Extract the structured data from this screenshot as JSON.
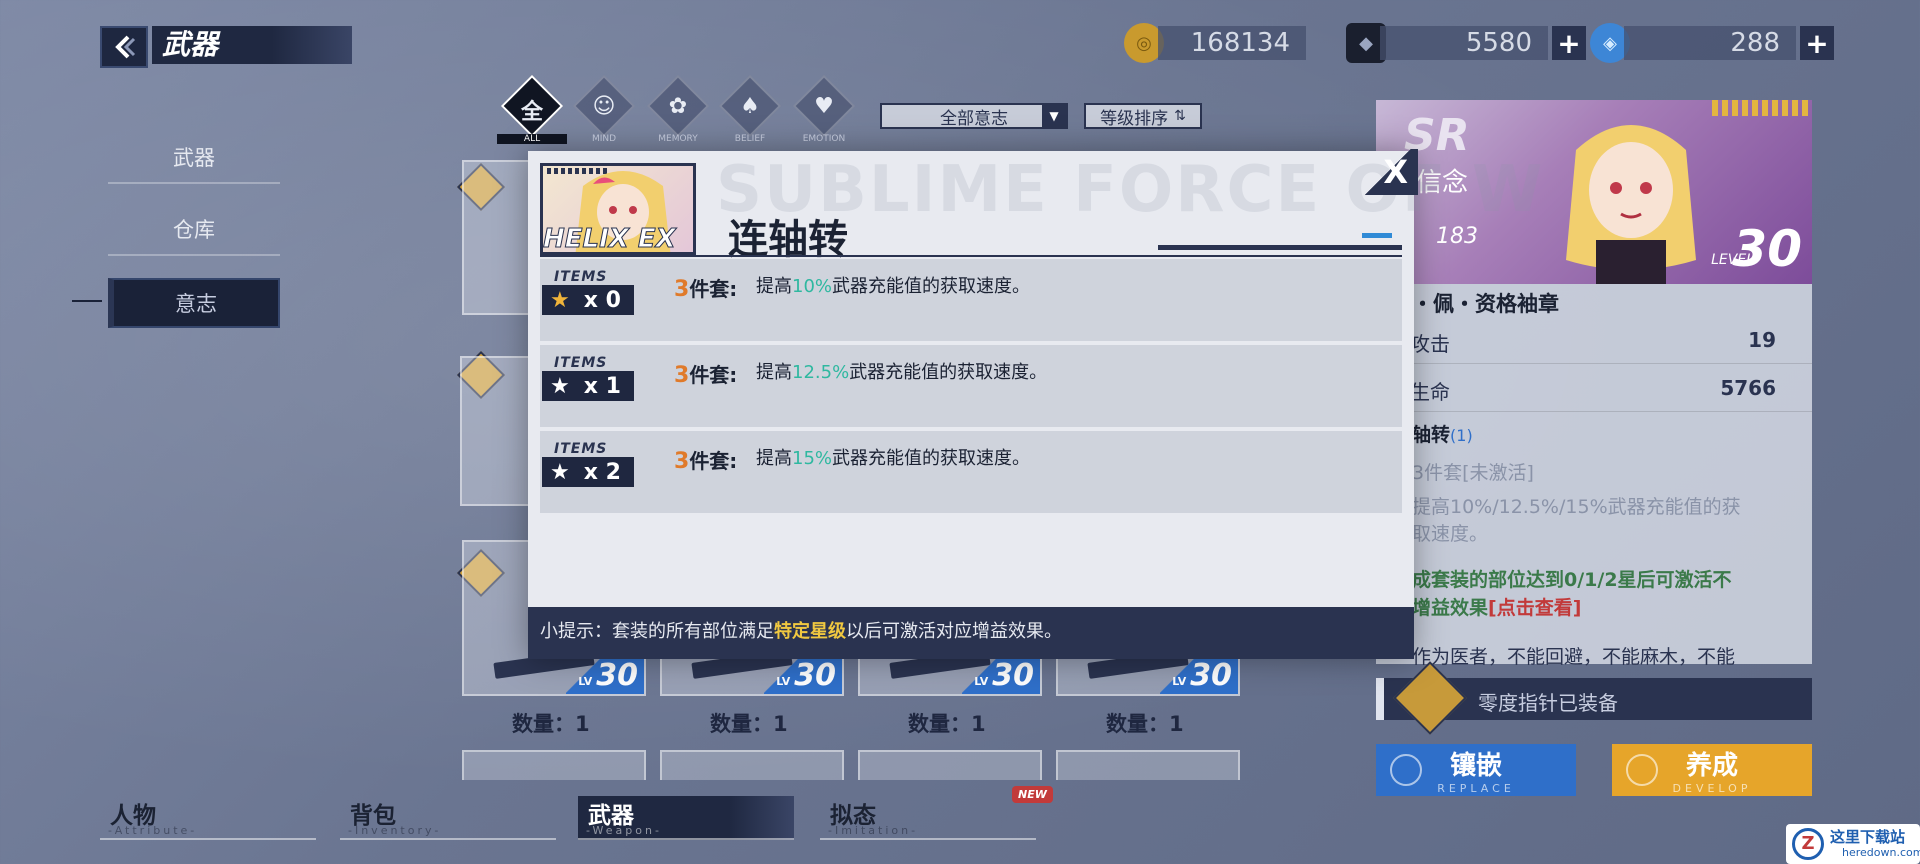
{
  "header": {
    "title": "武器",
    "currencies": [
      {
        "icon": "gold-coin-icon",
        "value": "168134",
        "has_plus": false
      },
      {
        "icon": "dark-crystal-icon",
        "value": "5580",
        "has_plus": true
      },
      {
        "icon": "blue-gem-icon",
        "value": "288",
        "has_plus": true
      }
    ]
  },
  "left_nav": {
    "items": [
      {
        "label": "武器",
        "active": false
      },
      {
        "label": "仓库",
        "active": false
      },
      {
        "label": "意志",
        "active": true
      }
    ]
  },
  "filters": {
    "categories": [
      {
        "glyph": "全",
        "label": "ALL",
        "active": true
      },
      {
        "glyph": "",
        "label": "MIND",
        "active": false
      },
      {
        "glyph": "",
        "label": "MEMORY",
        "active": false
      },
      {
        "glyph": "",
        "label": "BELIEF",
        "active": false
      },
      {
        "glyph": "",
        "label": "EMOTION",
        "active": false
      }
    ],
    "will_select": "全部意志",
    "sort_select": "等级排序"
  },
  "grid": {
    "cards": [
      {
        "level": "30",
        "quantity": "数量：1"
      },
      {
        "level": "30",
        "quantity": "数量：1"
      },
      {
        "level": "30",
        "quantity": "数量：1"
      },
      {
        "level": "30",
        "quantity": "数量：1"
      }
    ],
    "lv_label": "LV"
  },
  "right_panel": {
    "rank": "SR",
    "belief_label": "信念",
    "level_label": "LEVEL",
    "level_value": "30",
    "item_name": "・佩・资格袖章",
    "stats": [
      {
        "label": "攻击",
        "value": "19"
      },
      {
        "label": "生命",
        "value": "5766"
      }
    ],
    "set_name": "轴转",
    "set_count": "(1)",
    "set_status": "3件套[未激活]",
    "set_effect_l1": "提高10%/12.5%/15%武器充能值的获",
    "set_effect_l2": "取速度。",
    "condition_l1": "成套装的部位达到0/1/2星后可激活不",
    "condition_l2": "增益效果",
    "condition_link": "[点击查看]",
    "description": "作为医者，不能回避，不能麻木，不能",
    "equipped": "零度指针已装备",
    "buttons": [
      {
        "main": "镶嵌",
        "sub": "REPLACE",
        "color": "#2f6fc9"
      },
      {
        "main": "养成",
        "sub": "DEVELOP",
        "color": "#e6a52a"
      }
    ]
  },
  "bottom_tabs": [
    {
      "main": "人物",
      "sub": "-Attribute-",
      "active": false
    },
    {
      "main": "背包",
      "sub": "-Inventory-",
      "active": false
    },
    {
      "main": "武器",
      "sub": "-Weapon-",
      "active": true
    },
    {
      "main": "拟态",
      "sub": "-Imitation-",
      "active": false,
      "badge": "NEW"
    }
  ],
  "modal": {
    "watermark": "SUBLIME FORCE OF W",
    "portrait_label": "HELIX EX",
    "title": "连轴转",
    "rows": [
      {
        "items_label": "ITEMS",
        "star_count": "x 0",
        "star_color": "gold",
        "set_num": "3",
        "set_unit": "件套:",
        "prefix": "提高",
        "pct": "10%",
        "suffix": "武器充能值的获取速度。"
      },
      {
        "items_label": "ITEMS",
        "star_count": "x 1",
        "star_color": "white",
        "set_num": "3",
        "set_unit": "件套:",
        "prefix": "提高",
        "pct": "12.5%",
        "suffix": "武器充能值的获取速度。"
      },
      {
        "items_label": "ITEMS",
        "star_count": "x 2",
        "star_color": "white",
        "set_num": "3",
        "set_unit": "件套:",
        "prefix": "提高",
        "pct": "15%",
        "suffix": "武器充能值的获取速度。"
      }
    ],
    "footer_prefix": "小提示：套装的所有部位满足",
    "footer_highlight": "特定星级",
    "footer_suffix": "以后可激活对应增益效果。",
    "close_glyph": "X"
  },
  "corner_watermark": {
    "logo": "Z",
    "site_name": "这里下载站",
    "site_url": "heredown.com"
  },
  "colors": {
    "accent_blue": "#2f6fc9",
    "highlight_teal": "#2fb8a0",
    "highlight_orange": "#e07a2a",
    "highlight_yellow": "#f0c840",
    "dark_navy": "#2a3350"
  }
}
